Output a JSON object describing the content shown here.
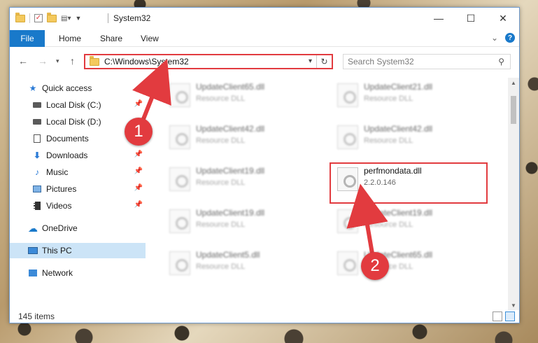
{
  "window": {
    "title": "System32",
    "caption": {
      "minimize": "—",
      "maximize": "☐",
      "close": "✕"
    }
  },
  "ribbon": {
    "tabs": [
      "File",
      "Home",
      "Share",
      "View"
    ],
    "expand_glyph": "⌄"
  },
  "navigation": {
    "address": "C:\\Windows\\System32",
    "search_placeholder": "Search System32"
  },
  "sidebar": {
    "items": [
      {
        "label": "Quick access",
        "icon": "star-icon",
        "pinned": false
      },
      {
        "label": "Local Disk (C:)",
        "icon": "drive-icon",
        "pinned": true
      },
      {
        "label": "Local Disk (D:)",
        "icon": "drive-icon",
        "pinned": false
      },
      {
        "label": "Documents",
        "icon": "documents-icon",
        "pinned": true
      },
      {
        "label": "Downloads",
        "icon": "download-icon",
        "pinned": true
      },
      {
        "label": "Music",
        "icon": "music-icon",
        "pinned": true
      },
      {
        "label": "Pictures",
        "icon": "pictures-icon",
        "pinned": true
      },
      {
        "label": "Videos",
        "icon": "videos-icon",
        "pinned": true
      },
      {
        "label": "OneDrive",
        "icon": "cloud-icon",
        "pinned": false
      },
      {
        "label": "This PC",
        "icon": "computer-icon",
        "pinned": false,
        "selected": true
      },
      {
        "label": "Network",
        "icon": "network-icon",
        "pinned": false
      }
    ]
  },
  "files": [
    {
      "name": "UpdateClient65.dll",
      "type": "Resource DLL"
    },
    {
      "name": "UpdateClient21.dll",
      "type": "Resource DLL"
    },
    {
      "name": "UpdateClient42.dll",
      "type": "Resource DLL"
    },
    {
      "name": "UpdateClient42.dll",
      "type": "Resource DLL"
    },
    {
      "name": "UpdateClient19.dll",
      "type": "Resource DLL"
    },
    {
      "name": "perfmondata.dll",
      "type": "2.2.0.146"
    },
    {
      "name": "UpdateClient19.dll",
      "type": "Resource DLL"
    },
    {
      "name": "UpdateClient19.dll",
      "type": "Resource DLL"
    },
    {
      "name": "UpdateClient5.dll",
      "type": "Resource DLL"
    },
    {
      "name": "UpdateClient65.dll",
      "type": "Resource DLL"
    }
  ],
  "status": {
    "items": "145 items"
  },
  "annotations": {
    "step1": "1",
    "step2": "2"
  },
  "colors": {
    "accent": "#1979ca",
    "highlight": "#e23b3f",
    "selected_bg": "#cce4f7"
  }
}
